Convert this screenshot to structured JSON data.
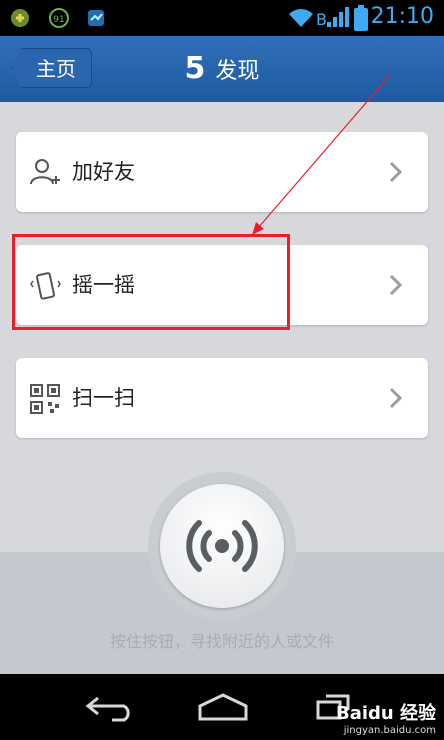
{
  "status_bar": {
    "time": "21:10",
    "carrier_label": "B",
    "badge_number": "91"
  },
  "header": {
    "back_label": "主页",
    "title_number": "5",
    "title": "发现"
  },
  "menu": [
    {
      "label": "加好友",
      "icon": "add-friend-icon"
    },
    {
      "label": "摇一摇",
      "icon": "shake-phone-icon"
    },
    {
      "label": "扫一扫",
      "icon": "qr-scan-icon"
    }
  ],
  "shake": {
    "hint": "按住按钮，寻找附近的人或文件"
  },
  "watermark": {
    "main": "Baidu 经验",
    "sub": "jingyan.baidu.com"
  },
  "colors": {
    "titlebar": "#2465ad",
    "highlight": "#e6202a",
    "time": "#3fa9f5"
  }
}
